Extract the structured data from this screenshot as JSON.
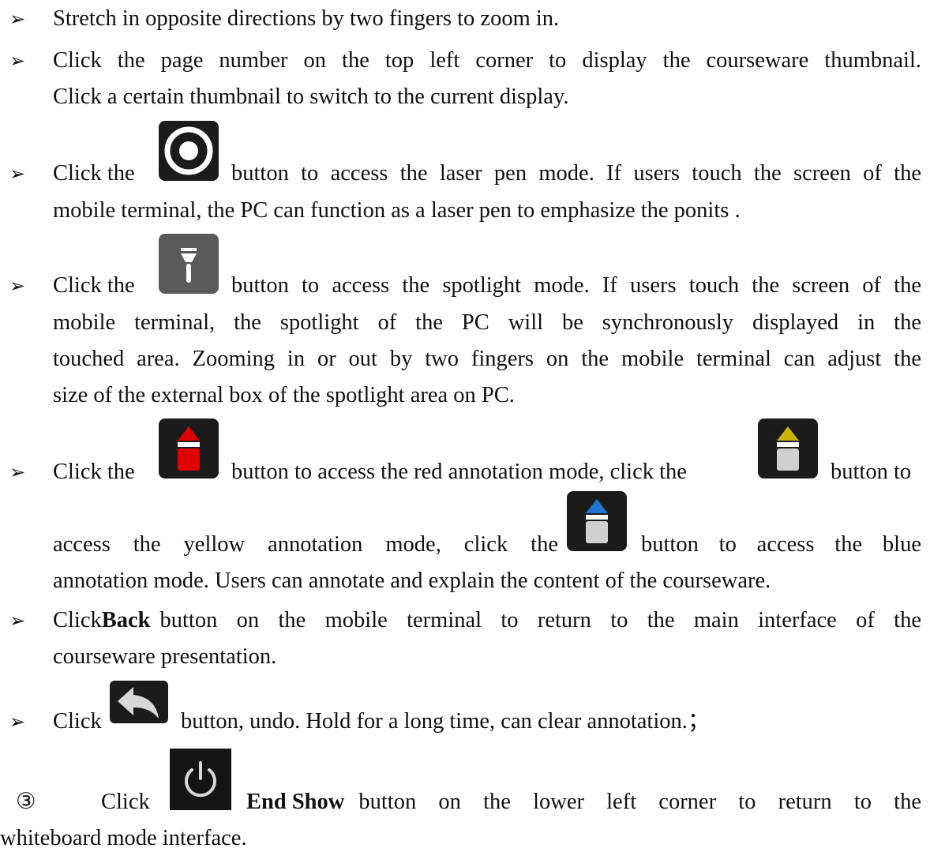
{
  "bullet_glyph": "➢",
  "items": [
    {
      "text": "Stretch in opposite directions by two fingers to zoom in."
    },
    {
      "line1": "Click the page number on the top left corner to display the courseware thumbnail.",
      "line2": "Click a certain thumbnail to switch to the current display."
    },
    {
      "pre": "Click the",
      "post": "button to access the laser pen mode. If users touch the screen of the",
      "line2": "mobile terminal, the PC can function as a laser pen to emphasize the ponits .",
      "icon": "laser-pen-icon"
    },
    {
      "pre": "Click the",
      "post": "button to access the spotlight mode. If users touch the screen of the",
      "line2": "mobile terminal, the spotlight of the PC will be synchronously displayed in the",
      "line3": "touched area. Zooming in or out by two fingers on the mobile terminal can adjust the",
      "line4": "size of the external box of the spotlight area on PC.",
      "icon": "spotlight-icon"
    },
    {
      "pre": "Click the",
      "mid": "button to access the red annotation mode, click the",
      "post": "button to",
      "line2_pre": "access the yellow annotation mode, click the",
      "line2_post": "button to access the blue",
      "line3": "annotation mode. Users can annotate and explain the content of the courseware.",
      "icons": [
        "red-pen-icon",
        "yellow-pen-icon",
        "blue-pen-icon"
      ],
      "colors": {
        "red": "#e00000",
        "yellow": "#c8b400",
        "blue": "#1e74d0"
      }
    },
    {
      "pre": "Click",
      "bold": "Back",
      "post": "button on the mobile terminal to return to the main interface of the",
      "line2": "courseware presentation."
    },
    {
      "pre": "Click",
      "post": "button, undo. Hold for a long time, can clear annotation.；",
      "icon": "undo-icon"
    }
  ],
  "step": {
    "number": "③",
    "pre": "Click",
    "bold": "End Show",
    "post": "button on the lower left corner to return to the",
    "line2": "whiteboard mode interface.",
    "icon": "power-icon"
  }
}
